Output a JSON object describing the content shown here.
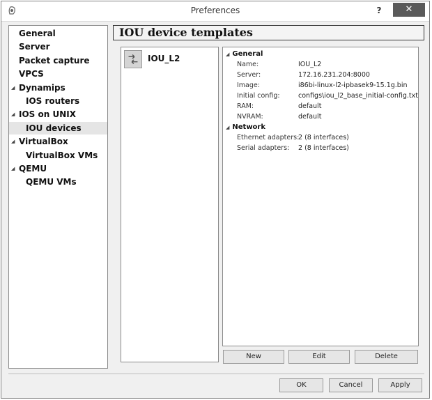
{
  "window": {
    "title": "Preferences",
    "help_label": "?",
    "close_label": "✕"
  },
  "nav": {
    "items": [
      {
        "label": "General",
        "indent": 0,
        "arrow": "",
        "selected": false
      },
      {
        "label": "Server",
        "indent": 0,
        "arrow": "",
        "selected": false
      },
      {
        "label": "Packet capture",
        "indent": 0,
        "arrow": "",
        "selected": false
      },
      {
        "label": "VPCS",
        "indent": 0,
        "arrow": "",
        "selected": false
      },
      {
        "label": "Dynamips",
        "indent": 0,
        "arrow": "◢",
        "selected": false
      },
      {
        "label": "IOS routers",
        "indent": 1,
        "arrow": "",
        "selected": false
      },
      {
        "label": "IOS on UNIX",
        "indent": 0,
        "arrow": "◢",
        "selected": false
      },
      {
        "label": "IOU devices",
        "indent": 1,
        "arrow": "",
        "selected": true
      },
      {
        "label": "VirtualBox",
        "indent": 0,
        "arrow": "◢",
        "selected": false
      },
      {
        "label": "VirtualBox VMs",
        "indent": 1,
        "arrow": "",
        "selected": false
      },
      {
        "label": "QEMU",
        "indent": 0,
        "arrow": "◢",
        "selected": false
      },
      {
        "label": "QEMU VMs",
        "indent": 1,
        "arrow": "",
        "selected": false
      }
    ]
  },
  "page": {
    "title": "IOU device templates"
  },
  "templates": [
    {
      "name": "IOU_L2",
      "icon": "switch-icon"
    }
  ],
  "details": {
    "general": {
      "header": "General",
      "fields": [
        {
          "key": "Name:",
          "value": "IOU_L2"
        },
        {
          "key": "Server:",
          "value": "172.16.231.204:8000"
        },
        {
          "key": "Image:",
          "value": "i86bi-linux-l2-ipbasek9-15.1g.bin"
        },
        {
          "key": "Initial config:",
          "value": "configs\\iou_l2_base_initial-config.txt"
        },
        {
          "key": "RAM:",
          "value": "default"
        },
        {
          "key": "NVRAM:",
          "value": "default"
        }
      ]
    },
    "network": {
      "header": "Network",
      "fields": [
        {
          "key": "Ethernet adapters:",
          "value": "2 (8 interfaces)"
        },
        {
          "key": "Serial adapters:",
          "value": "2 (8 interfaces)"
        }
      ]
    }
  },
  "actions": {
    "new_label": "New",
    "edit_label": "Edit",
    "delete_label": "Delete"
  },
  "footer": {
    "ok_label": "OK",
    "cancel_label": "Cancel",
    "apply_label": "Apply"
  }
}
